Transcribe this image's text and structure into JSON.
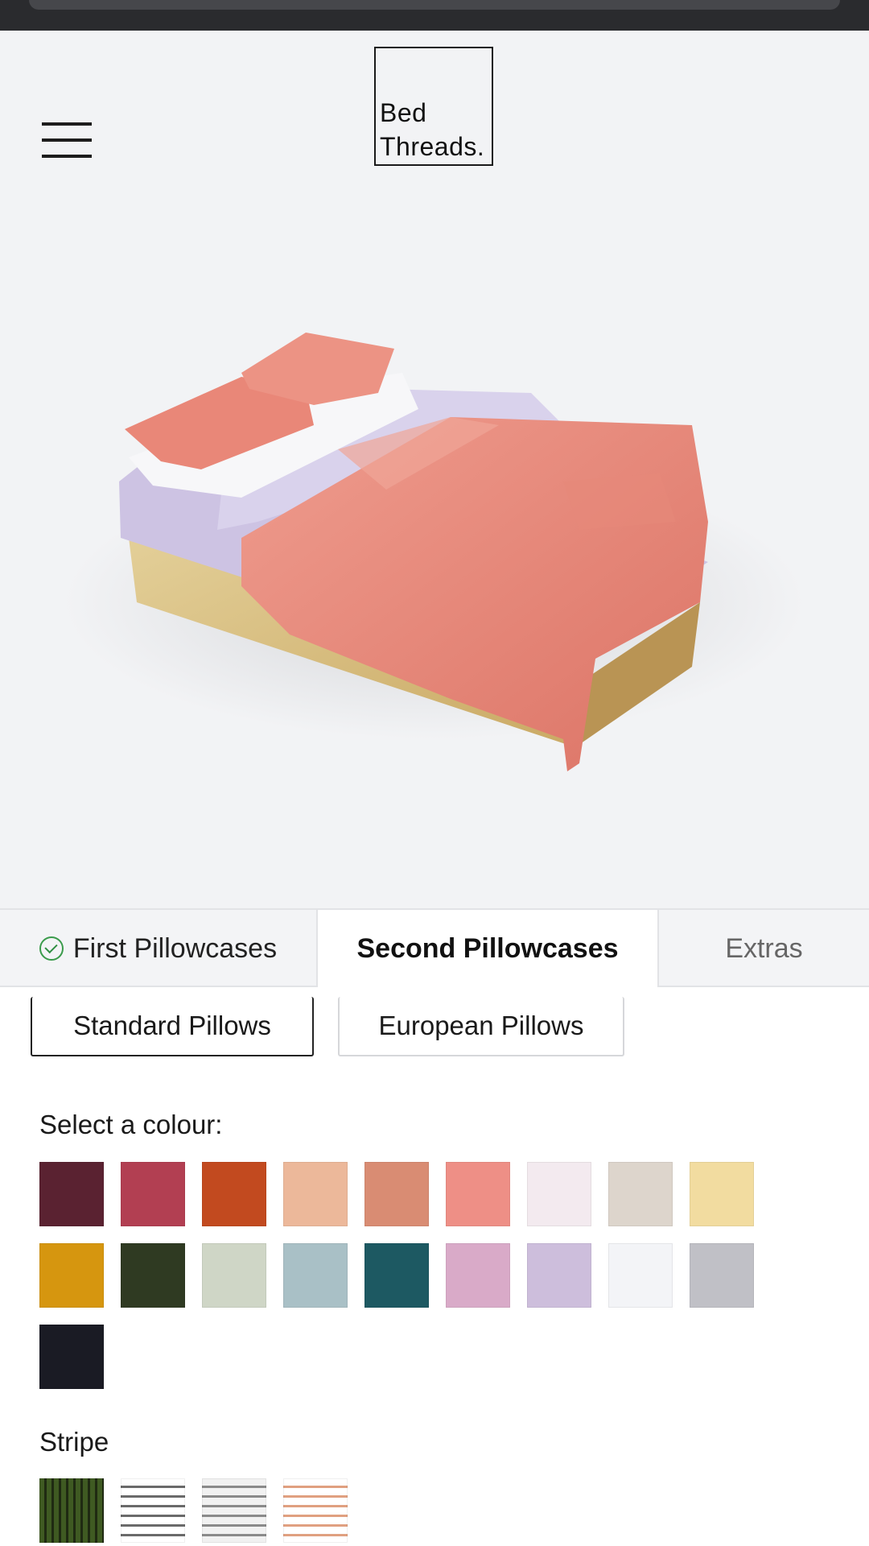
{
  "brand": {
    "line1": "Bed",
    "line2": "Threads."
  },
  "tabs": [
    {
      "label": "First Pillowcases",
      "state": "completed"
    },
    {
      "label": "Second Pillowcases",
      "state": "active"
    },
    {
      "label": "Extras",
      "state": "inactive"
    }
  ],
  "size_options": [
    {
      "label": "Standard Pillows",
      "selected": true
    },
    {
      "label": "European Pillows",
      "selected": false
    }
  ],
  "colour_section": {
    "label": "Select a colour:"
  },
  "colours": [
    "#5a2231",
    "#b23f52",
    "#c24a1f",
    "#ecb89a",
    "#d98c73",
    "#ee8f86",
    "#f3eaef",
    "#ddd5cc",
    "#f2dca0",
    "#d6960f",
    "#2f3a22",
    "#cfd6c6",
    "#a9c0c6",
    "#1d5962",
    "#d9aac8",
    "#cdbedc",
    "#f3f4f7",
    "#c0c0c6",
    "#1a1b24"
  ],
  "stripe_section": {
    "label": "Stripe"
  },
  "stripes": [
    {
      "base": "#3f5a22",
      "line": "#1f2a12"
    },
    {
      "base": "#ffffff",
      "line": "#6a6a6a"
    },
    {
      "base": "#f1f1f1",
      "line": "#8a8a8a"
    },
    {
      "base": "#ffffff",
      "line": "#e0a080"
    }
  ],
  "icons": {
    "menu": "hamburger-menu-icon",
    "tab_complete": "check-circle-icon"
  }
}
